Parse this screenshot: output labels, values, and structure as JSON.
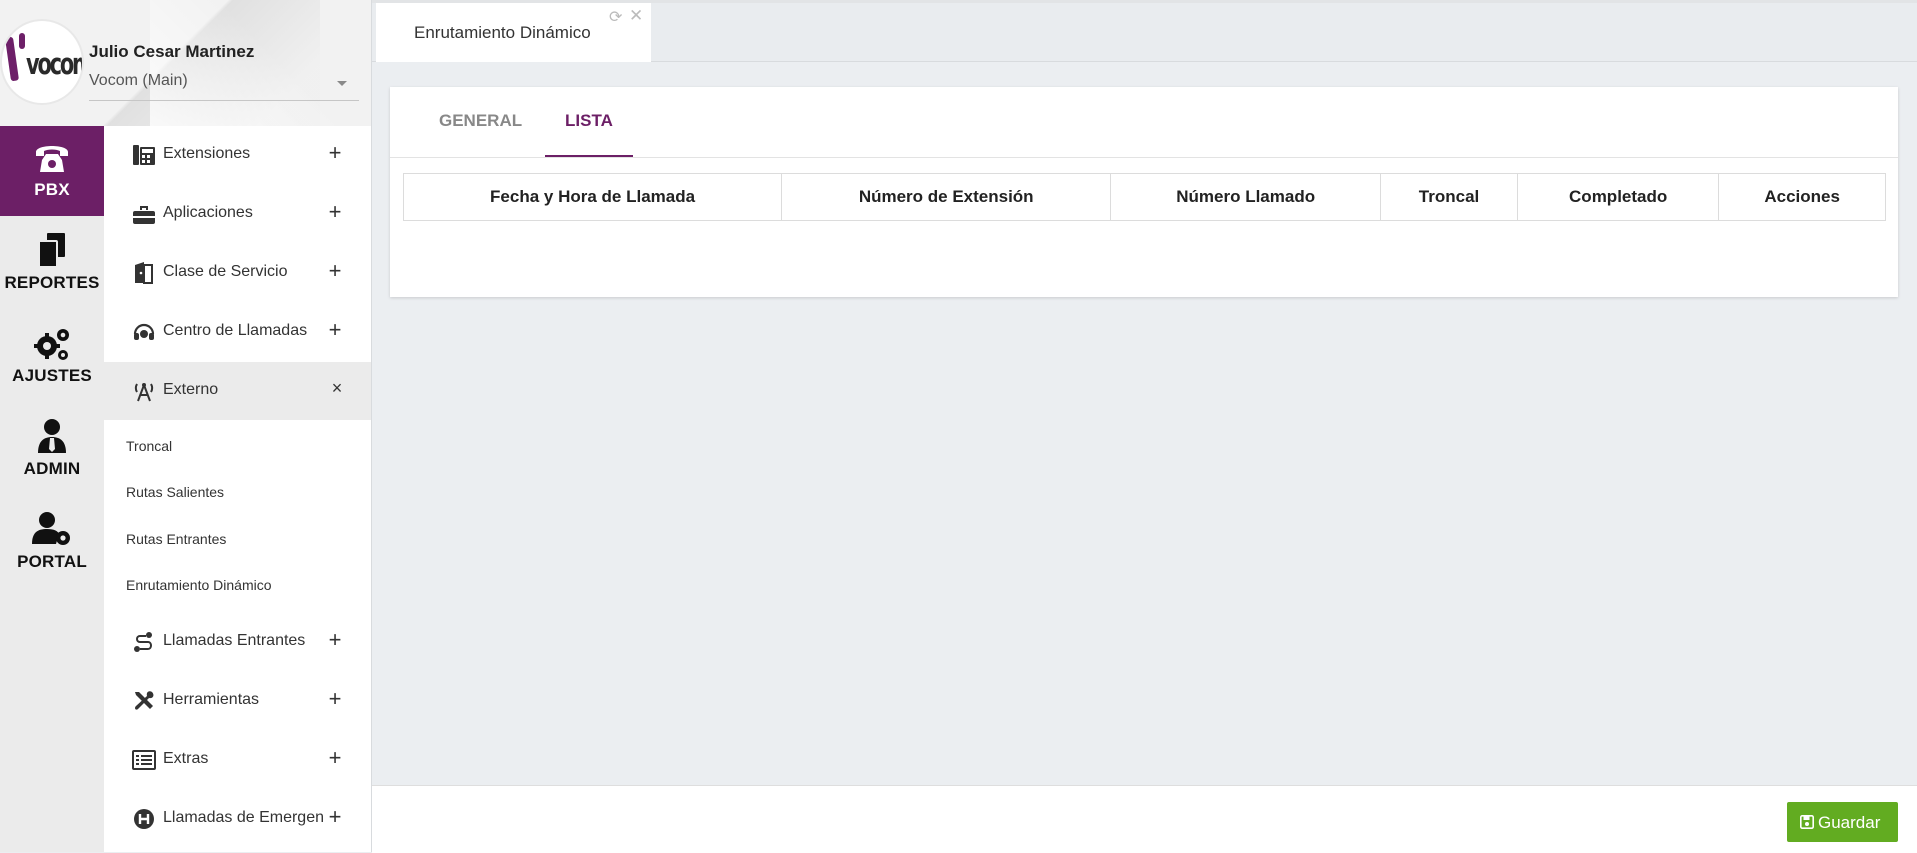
{
  "user": {
    "name": "Julio Cesar Martinez",
    "organization": "Vocom (Main)",
    "logo_text": "vocom"
  },
  "rail": [
    {
      "label": "PBX",
      "icon": "phone-icon",
      "active": true
    },
    {
      "label": "REPORTES",
      "icon": "documents-icon",
      "active": false
    },
    {
      "label": "AJUSTES",
      "icon": "gears-icon",
      "active": false
    },
    {
      "label": "ADMIN",
      "icon": "user-tie-icon",
      "active": false
    },
    {
      "label": "PORTAL",
      "icon": "user-gear-icon",
      "active": false
    }
  ],
  "menu": {
    "items": [
      {
        "label": "Extensiones",
        "icon": "phone-office-icon",
        "state": "+"
      },
      {
        "label": "Aplicaciones",
        "icon": "toolbox-icon",
        "state": "+"
      },
      {
        "label": "Clase de Servicio",
        "icon": "door-icon",
        "state": "+"
      },
      {
        "label": "Centro de Llamadas",
        "icon": "headset-icon",
        "state": "+"
      },
      {
        "label": "Externo",
        "icon": "antenna-icon",
        "state": "×"
      },
      {
        "label": "Llamadas Entrantes",
        "icon": "route-icon",
        "state": "+"
      },
      {
        "label": "Herramientas",
        "icon": "tools-icon",
        "state": "+"
      },
      {
        "label": "Extras",
        "icon": "list-icon",
        "state": "+"
      },
      {
        "label": "Llamadas de Emergen",
        "icon": "hospital-icon",
        "state": "+"
      }
    ],
    "sub_items": [
      "Troncal",
      "Rutas Salientes",
      "Rutas Entrantes",
      "Enrutamiento Dinámico"
    ]
  },
  "page_tab": {
    "title": "Enrutamiento Dinámico",
    "refresh_glyph": "⟳",
    "close_glyph": "✕"
  },
  "card": {
    "tabs": [
      "GENERAL",
      "LISTA"
    ],
    "active_tab": "LISTA",
    "table": {
      "headers": [
        "Fecha y Hora de Llamada",
        "Número de Extensión",
        "Número Llamado",
        "Troncal",
        "Completado",
        "Acciones"
      ],
      "rows": []
    }
  },
  "footer": {
    "save_label": "Guardar"
  },
  "colors": {
    "brand": "#6c1f66",
    "save": "#62ac21",
    "background": "#ebeef1"
  }
}
